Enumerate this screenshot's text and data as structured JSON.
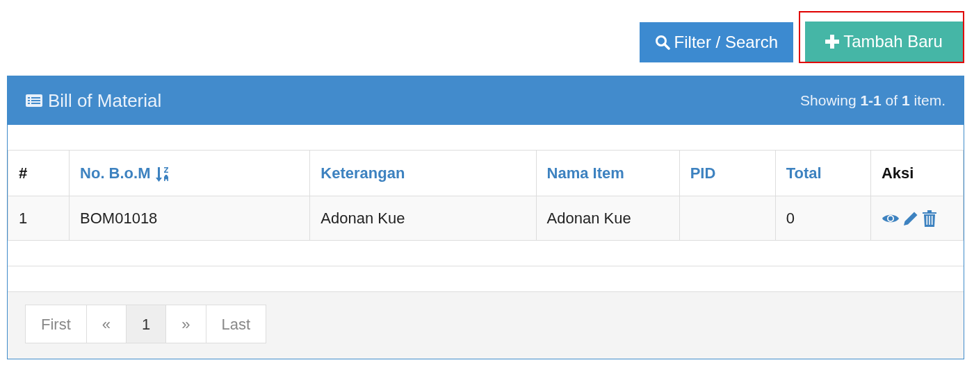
{
  "toolbar": [
    {
      "kind": "filter",
      "label": "Filter / Search",
      "highlighted": false
    },
    {
      "kind": "add",
      "label": "Tambah Baru",
      "highlighted": true
    }
  ],
  "panel": {
    "title": "Bill of Material",
    "summary": "Showing **1-1** of **1** item."
  },
  "table": {
    "columns": [
      {
        "label": "#",
        "sortable": false,
        "sorted": false
      },
      {
        "label": "No. B.o.M",
        "sortable": true,
        "sorted": true
      },
      {
        "label": "Keterangan",
        "sortable": true,
        "sorted": false
      },
      {
        "label": "Nama Item",
        "sortable": true,
        "sorted": false
      },
      {
        "label": "PID",
        "sortable": true,
        "sorted": false
      },
      {
        "label": "Total",
        "sortable": true,
        "sorted": false
      },
      {
        "label": "Aksi",
        "sortable": false,
        "sorted": false
      }
    ],
    "rows": [
      {
        "cells": [
          "1",
          "BOM01018",
          "Adonan Kue",
          "Adonan Kue",
          "",
          "0"
        ],
        "actions": [
          {
            "kind": "view"
          },
          {
            "kind": "edit"
          },
          {
            "kind": "delete"
          }
        ]
      }
    ]
  },
  "pagination": [
    {
      "label": "First",
      "selected": false
    },
    {
      "label": "«",
      "selected": false
    },
    {
      "label": "1",
      "selected": true
    },
    {
      "label": "»",
      "selected": false
    },
    {
      "label": "Last",
      "selected": false
    }
  ]
}
